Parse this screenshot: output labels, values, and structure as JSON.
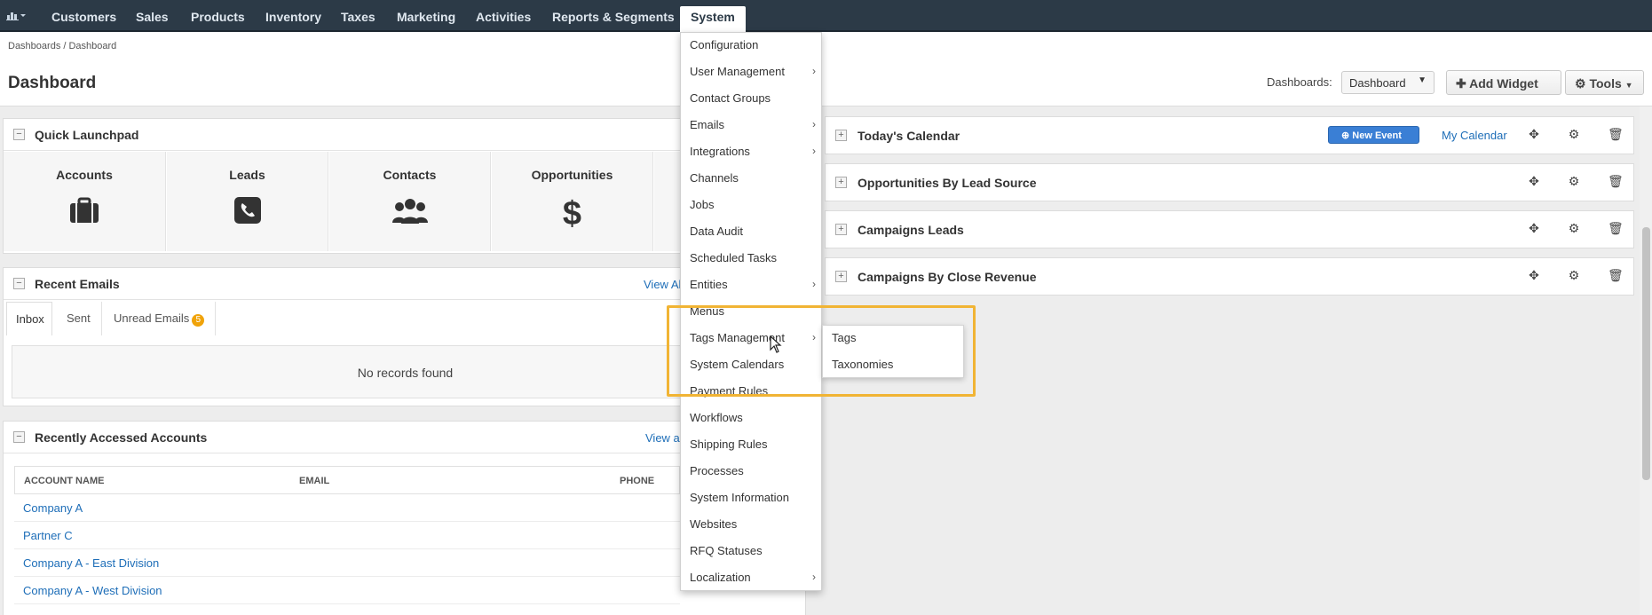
{
  "nav": {
    "brand_icon": "chart-icon",
    "items": [
      "Customers",
      "Sales",
      "Products",
      "Inventory",
      "Taxes",
      "Marketing",
      "Activities",
      "Reports & Segments",
      "System"
    ]
  },
  "breadcrumb": "Dashboards / Dashboard",
  "page_title": "Dashboard",
  "toolbar": {
    "dashboards_label": "Dashboards:",
    "dashboard_select": "Dashboard",
    "add_widget": "Add Widget",
    "tools": "Tools"
  },
  "quick_launchpad": {
    "title": "Quick Launchpad",
    "items": [
      "Accounts",
      "Leads",
      "Contacts",
      "Opportunities"
    ]
  },
  "recent_emails": {
    "title": "Recent Emails",
    "view_all": "View Al",
    "tabs": [
      "Inbox",
      "Sent",
      "Unread Emails"
    ],
    "unread_count": "5",
    "empty": "No records found"
  },
  "recent_accounts": {
    "title": "Recently Accessed Accounts",
    "view_all": "View al",
    "columns": [
      "ACCOUNT NAME",
      "EMAIL",
      "PHONE"
    ],
    "rows": [
      "Company A",
      "Partner C",
      "Company A - East Division",
      "Company A - West Division"
    ]
  },
  "right_widgets": [
    {
      "title": "Today's Calendar",
      "new_event": "New Event",
      "my_calendar": "My Calendar"
    },
    {
      "title": "Opportunities By Lead Source"
    },
    {
      "title": "Campaigns Leads"
    },
    {
      "title": "Campaigns By Close Revenue"
    }
  ],
  "system_menu": [
    {
      "label": "Configuration",
      "sub": false
    },
    {
      "label": "User Management",
      "sub": true
    },
    {
      "label": "Contact Groups",
      "sub": false
    },
    {
      "label": "Emails",
      "sub": true
    },
    {
      "label": "Integrations",
      "sub": true
    },
    {
      "label": "Channels",
      "sub": false
    },
    {
      "label": "Jobs",
      "sub": false
    },
    {
      "label": "Data Audit",
      "sub": false
    },
    {
      "label": "Scheduled Tasks",
      "sub": false
    },
    {
      "label": "Entities",
      "sub": true
    },
    {
      "label": "Menus",
      "sub": false
    },
    {
      "label": "Tags Management",
      "sub": true
    },
    {
      "label": "System Calendars",
      "sub": false
    },
    {
      "label": "Payment Rules",
      "sub": false
    },
    {
      "label": "Workflows",
      "sub": false
    },
    {
      "label": "Shipping Rules",
      "sub": false
    },
    {
      "label": "Processes",
      "sub": false
    },
    {
      "label": "System Information",
      "sub": false
    },
    {
      "label": "Websites",
      "sub": false
    },
    {
      "label": "RFQ Statuses",
      "sub": false
    },
    {
      "label": "Localization",
      "sub": true
    }
  ],
  "tags_submenu": [
    "Tags",
    "Taxonomies"
  ],
  "colors": {
    "nav_bg": "#2c3a47",
    "link": "#1e6eb8",
    "primary_button": "#3a7fd5",
    "highlight": "#f1b434",
    "badge": "#f0a30a"
  }
}
